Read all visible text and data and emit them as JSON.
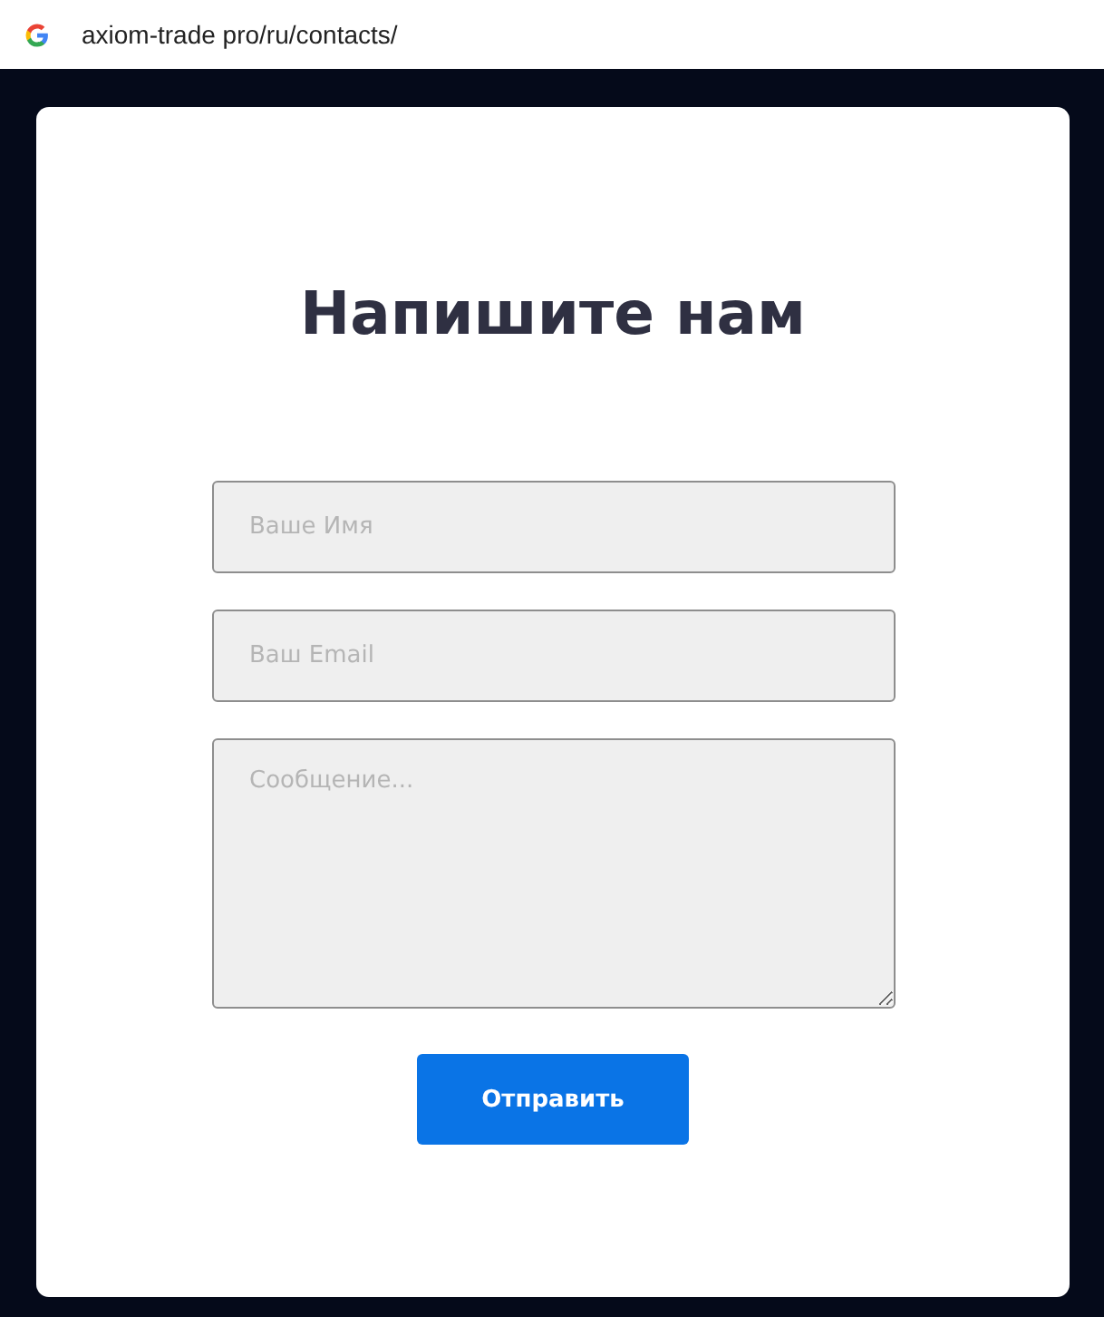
{
  "address_bar": {
    "url": "axiom-trade pro/ru/contacts/"
  },
  "form": {
    "title": "Напишите нам",
    "fields": [
      {
        "kind": "input",
        "placeholder": "Ваше Имя"
      },
      {
        "kind": "input",
        "placeholder": "Ваш Email"
      },
      {
        "kind": "textarea",
        "placeholder": "Сообщение..."
      }
    ],
    "submit": "Отправить"
  }
}
